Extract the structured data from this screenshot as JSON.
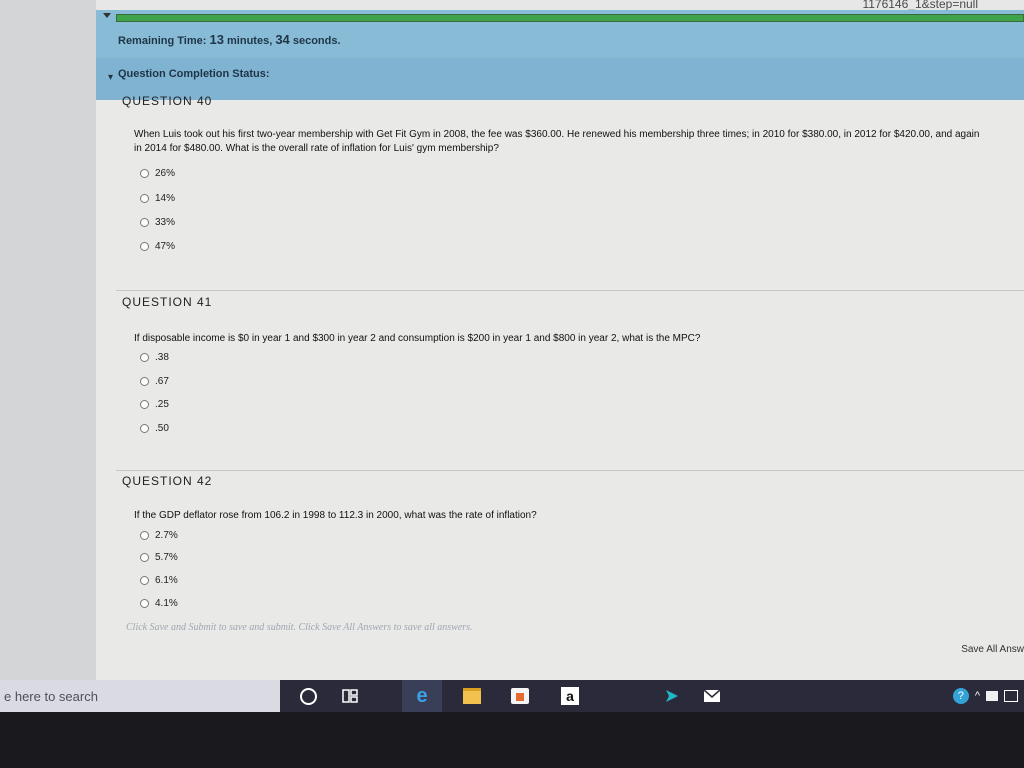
{
  "browser": {
    "url_fragment": "1176146_1&step=null"
  },
  "timer": {
    "label": "Remaining Time:",
    "minutes": "13",
    "minutes_unit": "minutes,",
    "seconds": "34",
    "seconds_unit": "seconds."
  },
  "status": {
    "toggle": "▾",
    "label": "Question Completion Status:"
  },
  "questions": [
    {
      "header": "QUESTION 40",
      "text": "When Luis took out his first two-year membership with Get Fit Gym in 2008, the fee was $360.00. He renewed his membership three times; in 2010 for $380.00, in 2012 for $420.00, and again in 2014 for $480.00. What is the overall rate of inflation for Luis' gym membership?",
      "options": [
        "26%",
        "14%",
        "33%",
        "47%"
      ]
    },
    {
      "header": "QUESTION 41",
      "text": "If disposable income is $0 in year 1 and $300 in year 2 and consumption is $200 in year 1 and $800 in year 2, what is the MPC?",
      "options": [
        ".38",
        ".67",
        ".25",
        ".50"
      ]
    },
    {
      "header": "QUESTION 42",
      "text": "If the GDP deflator rose from 106.2 in 1998 to 112.3 in 2000, what was the rate of inflation?",
      "options": [
        "2.7%",
        "5.7%",
        "6.1%",
        "4.1%"
      ]
    }
  ],
  "footer_note": "Click Save and Submit to save and submit. Click Save All Answers to save all answers.",
  "save_all_label": "Save All Answ",
  "taskbar": {
    "search_placeholder": "e here to search",
    "amazon_letter": "a",
    "help_glyph": "?",
    "tray_up": "^"
  }
}
